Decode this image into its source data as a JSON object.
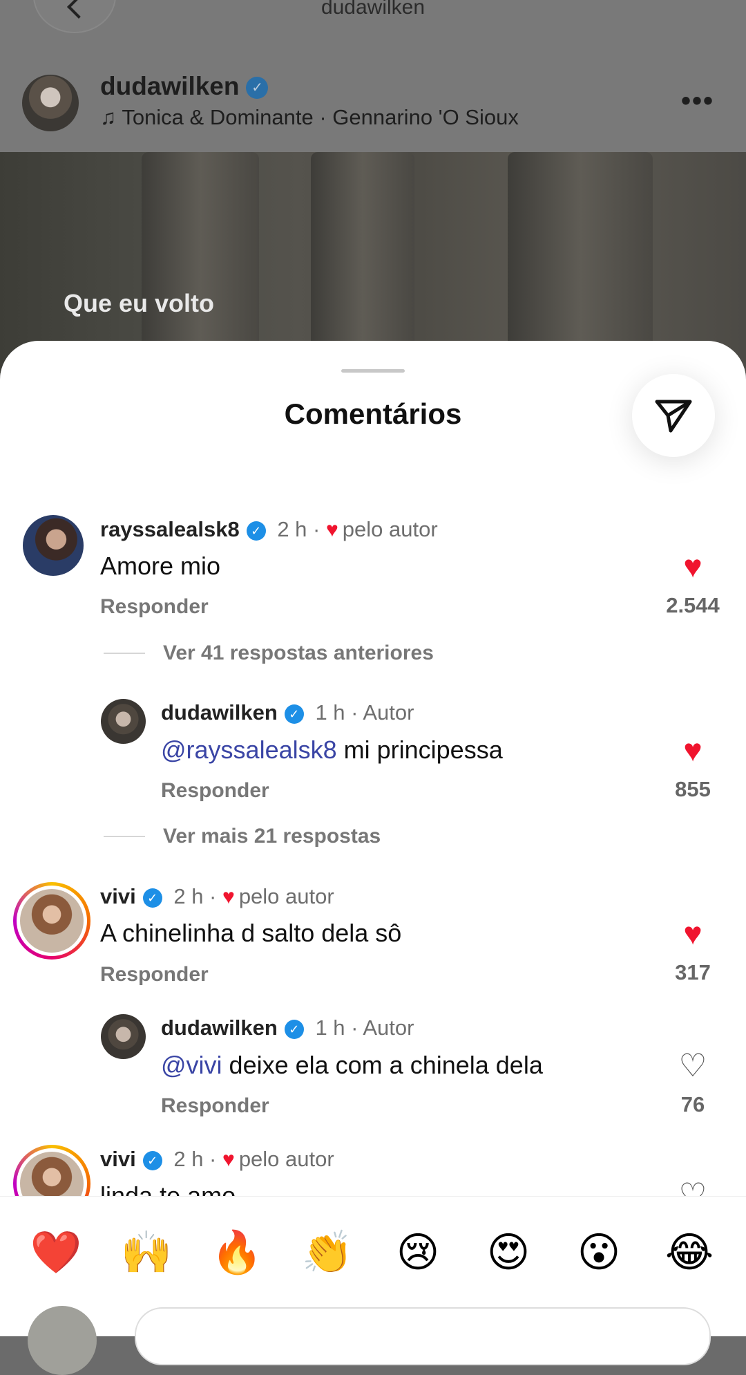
{
  "header": {
    "username_top": "dudawilken",
    "post_username": "dudawilken",
    "music_icon": "♫",
    "music": "Tonica & Dominante · Gennarino 'O Sioux",
    "more_icon": "•••"
  },
  "video": {
    "caption": "Que eu volto"
  },
  "sheet": {
    "title": "Comentários"
  },
  "comments": [
    {
      "username": "rayssalealsk8",
      "time": "2 h ·",
      "liked_by_author": "pelo autor",
      "text": "Amore mio",
      "reply": "Responder",
      "likes": "2.544",
      "liked": true,
      "thread": "Ver 41 respostas anteriores"
    },
    {
      "username": "dudawilken",
      "time": "1 h ·",
      "role": "Autor",
      "mention": "@rayssalealsk8",
      "text": " mi principessa",
      "reply": "Responder",
      "likes": "855",
      "liked": true,
      "thread": "Ver mais 21 respostas"
    },
    {
      "username": "vivi",
      "time": "2 h ·",
      "liked_by_author": "pelo autor",
      "text": "A chinelinha d salto dela sô",
      "reply": "Responder",
      "likes": "317",
      "liked": true
    },
    {
      "username": "dudawilken",
      "time": "1 h ·",
      "role": "Autor",
      "mention": "@vivi",
      "text": " deixe ela com a chinela dela",
      "reply": "Responder",
      "likes": "76",
      "liked": false
    },
    {
      "username": "vivi",
      "time": "2 h ·",
      "liked_by_author": "pelo autor",
      "text": "linda te amo"
    }
  ],
  "reactions": [
    "❤️",
    "🙌",
    "🔥",
    "👏",
    "😢",
    "😍",
    "😮",
    "😂"
  ],
  "icons": {
    "verified": "✓",
    "heart_filled": "♥",
    "heart_empty": "♡",
    "share": "paper-plane-icon"
  },
  "colors": {
    "like_red": "#f0142e",
    "verified_blue": "#1d8fe6",
    "mention": "#3a45a5"
  }
}
